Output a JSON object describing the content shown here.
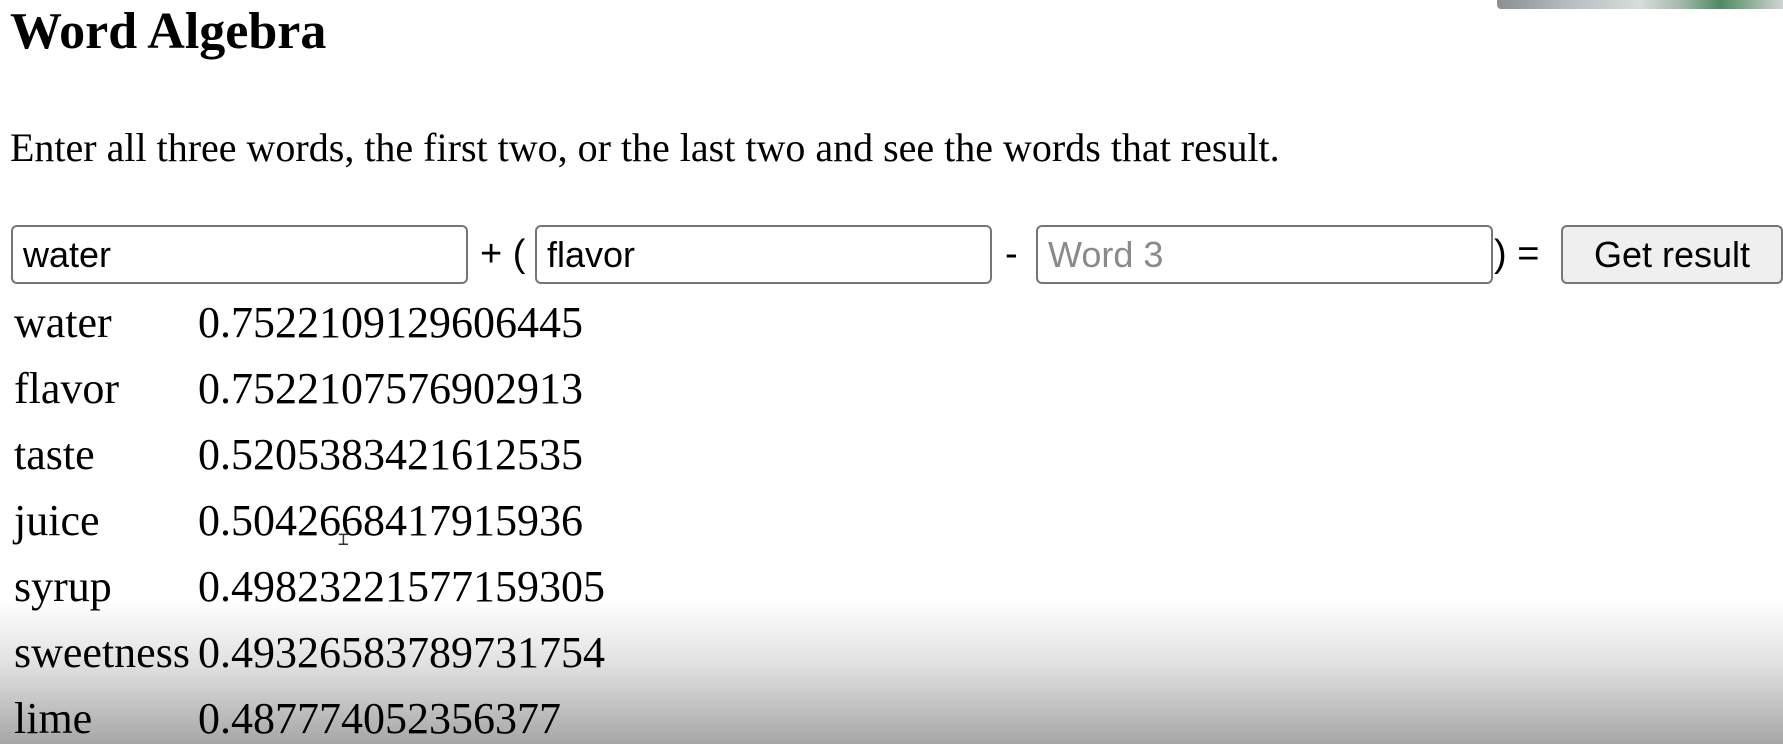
{
  "page": {
    "title": "Word Algebra",
    "instructions": "Enter all three words, the first two, or the last two and see the words that result."
  },
  "form": {
    "word1": {
      "value": "water",
      "placeholder": ""
    },
    "op_plus": "+ (",
    "word2": {
      "value": "flavor",
      "placeholder": ""
    },
    "op_minus": "-",
    "word3": {
      "value": "",
      "placeholder": "Word 3"
    },
    "op_equals": ") =",
    "submit_label": "Get result"
  },
  "results": [
    {
      "word": "water",
      "score": "0.7522109129606445"
    },
    {
      "word": "flavor",
      "score": "0.7522107576902913"
    },
    {
      "word": "taste",
      "score": "0.5205383421612535"
    },
    {
      "word": "juice",
      "score": "0.5042668417915936"
    },
    {
      "word": "syrup",
      "score": "0.49823221577159305"
    },
    {
      "word": "sweetness",
      "score": "0.49326583789731754"
    },
    {
      "word": "lime",
      "score": "0.487774052356377"
    }
  ],
  "icons": {
    "text_cursor": "text-cursor-icon"
  },
  "colors": {
    "input_border": "#767676",
    "button_background": "#efefef",
    "placeholder_text": "#8a8a8a"
  }
}
